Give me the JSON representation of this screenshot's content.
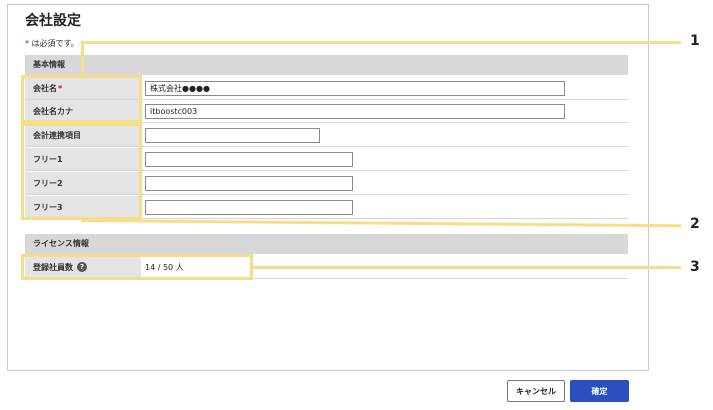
{
  "page": {
    "title": "会社設定",
    "required_star": "*",
    "required_note": " は必須です。"
  },
  "basic_info": {
    "header": "基本情報",
    "company_name": {
      "label": "会社名",
      "required_mark": "*",
      "value": "株式会社●●●●"
    },
    "company_kana": {
      "label": "会社名カナ",
      "value": "itboostc003"
    },
    "accounting_item": {
      "label": "会計連携項目",
      "value": ""
    },
    "free1": {
      "label": "フリー1",
      "value": ""
    },
    "free2": {
      "label": "フリー2",
      "value": ""
    },
    "free3": {
      "label": "フリー3",
      "value": ""
    }
  },
  "license_info": {
    "header": "ライセンス情報",
    "registered_staff": {
      "label": "登録社員数",
      "help_icon": "question-circle-icon",
      "help_glyph": "?",
      "value": "14 / 50 人"
    }
  },
  "footer": {
    "cancel_label": "キャンセル",
    "confirm_label": "確定"
  },
  "callouts": [
    "1",
    "2",
    "3"
  ],
  "colors": {
    "highlight": "#f7dc8a",
    "confirm_button": "#2a4fbf",
    "required_mark": "#d0021b",
    "section_header": "#d8d8d8"
  }
}
